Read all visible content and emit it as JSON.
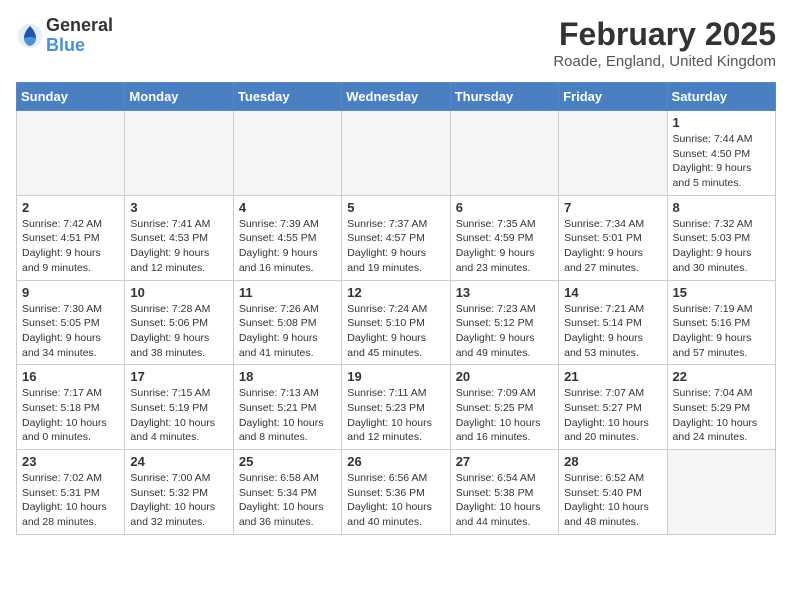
{
  "logo": {
    "general": "General",
    "blue": "Blue"
  },
  "title": "February 2025",
  "subtitle": "Roade, England, United Kingdom",
  "headers": [
    "Sunday",
    "Monday",
    "Tuesday",
    "Wednesday",
    "Thursday",
    "Friday",
    "Saturday"
  ],
  "weeks": [
    [
      {
        "day": "",
        "detail": ""
      },
      {
        "day": "",
        "detail": ""
      },
      {
        "day": "",
        "detail": ""
      },
      {
        "day": "",
        "detail": ""
      },
      {
        "day": "",
        "detail": ""
      },
      {
        "day": "",
        "detail": ""
      },
      {
        "day": "1",
        "detail": "Sunrise: 7:44 AM\nSunset: 4:50 PM\nDaylight: 9 hours and 5 minutes."
      }
    ],
    [
      {
        "day": "2",
        "detail": "Sunrise: 7:42 AM\nSunset: 4:51 PM\nDaylight: 9 hours and 9 minutes."
      },
      {
        "day": "3",
        "detail": "Sunrise: 7:41 AM\nSunset: 4:53 PM\nDaylight: 9 hours and 12 minutes."
      },
      {
        "day": "4",
        "detail": "Sunrise: 7:39 AM\nSunset: 4:55 PM\nDaylight: 9 hours and 16 minutes."
      },
      {
        "day": "5",
        "detail": "Sunrise: 7:37 AM\nSunset: 4:57 PM\nDaylight: 9 hours and 19 minutes."
      },
      {
        "day": "6",
        "detail": "Sunrise: 7:35 AM\nSunset: 4:59 PM\nDaylight: 9 hours and 23 minutes."
      },
      {
        "day": "7",
        "detail": "Sunrise: 7:34 AM\nSunset: 5:01 PM\nDaylight: 9 hours and 27 minutes."
      },
      {
        "day": "8",
        "detail": "Sunrise: 7:32 AM\nSunset: 5:03 PM\nDaylight: 9 hours and 30 minutes."
      }
    ],
    [
      {
        "day": "9",
        "detail": "Sunrise: 7:30 AM\nSunset: 5:05 PM\nDaylight: 9 hours and 34 minutes."
      },
      {
        "day": "10",
        "detail": "Sunrise: 7:28 AM\nSunset: 5:06 PM\nDaylight: 9 hours and 38 minutes."
      },
      {
        "day": "11",
        "detail": "Sunrise: 7:26 AM\nSunset: 5:08 PM\nDaylight: 9 hours and 41 minutes."
      },
      {
        "day": "12",
        "detail": "Sunrise: 7:24 AM\nSunset: 5:10 PM\nDaylight: 9 hours and 45 minutes."
      },
      {
        "day": "13",
        "detail": "Sunrise: 7:23 AM\nSunset: 5:12 PM\nDaylight: 9 hours and 49 minutes."
      },
      {
        "day": "14",
        "detail": "Sunrise: 7:21 AM\nSunset: 5:14 PM\nDaylight: 9 hours and 53 minutes."
      },
      {
        "day": "15",
        "detail": "Sunrise: 7:19 AM\nSunset: 5:16 PM\nDaylight: 9 hours and 57 minutes."
      }
    ],
    [
      {
        "day": "16",
        "detail": "Sunrise: 7:17 AM\nSunset: 5:18 PM\nDaylight: 10 hours and 0 minutes."
      },
      {
        "day": "17",
        "detail": "Sunrise: 7:15 AM\nSunset: 5:19 PM\nDaylight: 10 hours and 4 minutes."
      },
      {
        "day": "18",
        "detail": "Sunrise: 7:13 AM\nSunset: 5:21 PM\nDaylight: 10 hours and 8 minutes."
      },
      {
        "day": "19",
        "detail": "Sunrise: 7:11 AM\nSunset: 5:23 PM\nDaylight: 10 hours and 12 minutes."
      },
      {
        "day": "20",
        "detail": "Sunrise: 7:09 AM\nSunset: 5:25 PM\nDaylight: 10 hours and 16 minutes."
      },
      {
        "day": "21",
        "detail": "Sunrise: 7:07 AM\nSunset: 5:27 PM\nDaylight: 10 hours and 20 minutes."
      },
      {
        "day": "22",
        "detail": "Sunrise: 7:04 AM\nSunset: 5:29 PM\nDaylight: 10 hours and 24 minutes."
      }
    ],
    [
      {
        "day": "23",
        "detail": "Sunrise: 7:02 AM\nSunset: 5:31 PM\nDaylight: 10 hours and 28 minutes."
      },
      {
        "day": "24",
        "detail": "Sunrise: 7:00 AM\nSunset: 5:32 PM\nDaylight: 10 hours and 32 minutes."
      },
      {
        "day": "25",
        "detail": "Sunrise: 6:58 AM\nSunset: 5:34 PM\nDaylight: 10 hours and 36 minutes."
      },
      {
        "day": "26",
        "detail": "Sunrise: 6:56 AM\nSunset: 5:36 PM\nDaylight: 10 hours and 40 minutes."
      },
      {
        "day": "27",
        "detail": "Sunrise: 6:54 AM\nSunset: 5:38 PM\nDaylight: 10 hours and 44 minutes."
      },
      {
        "day": "28",
        "detail": "Sunrise: 6:52 AM\nSunset: 5:40 PM\nDaylight: 10 hours and 48 minutes."
      },
      {
        "day": "",
        "detail": ""
      }
    ]
  ]
}
